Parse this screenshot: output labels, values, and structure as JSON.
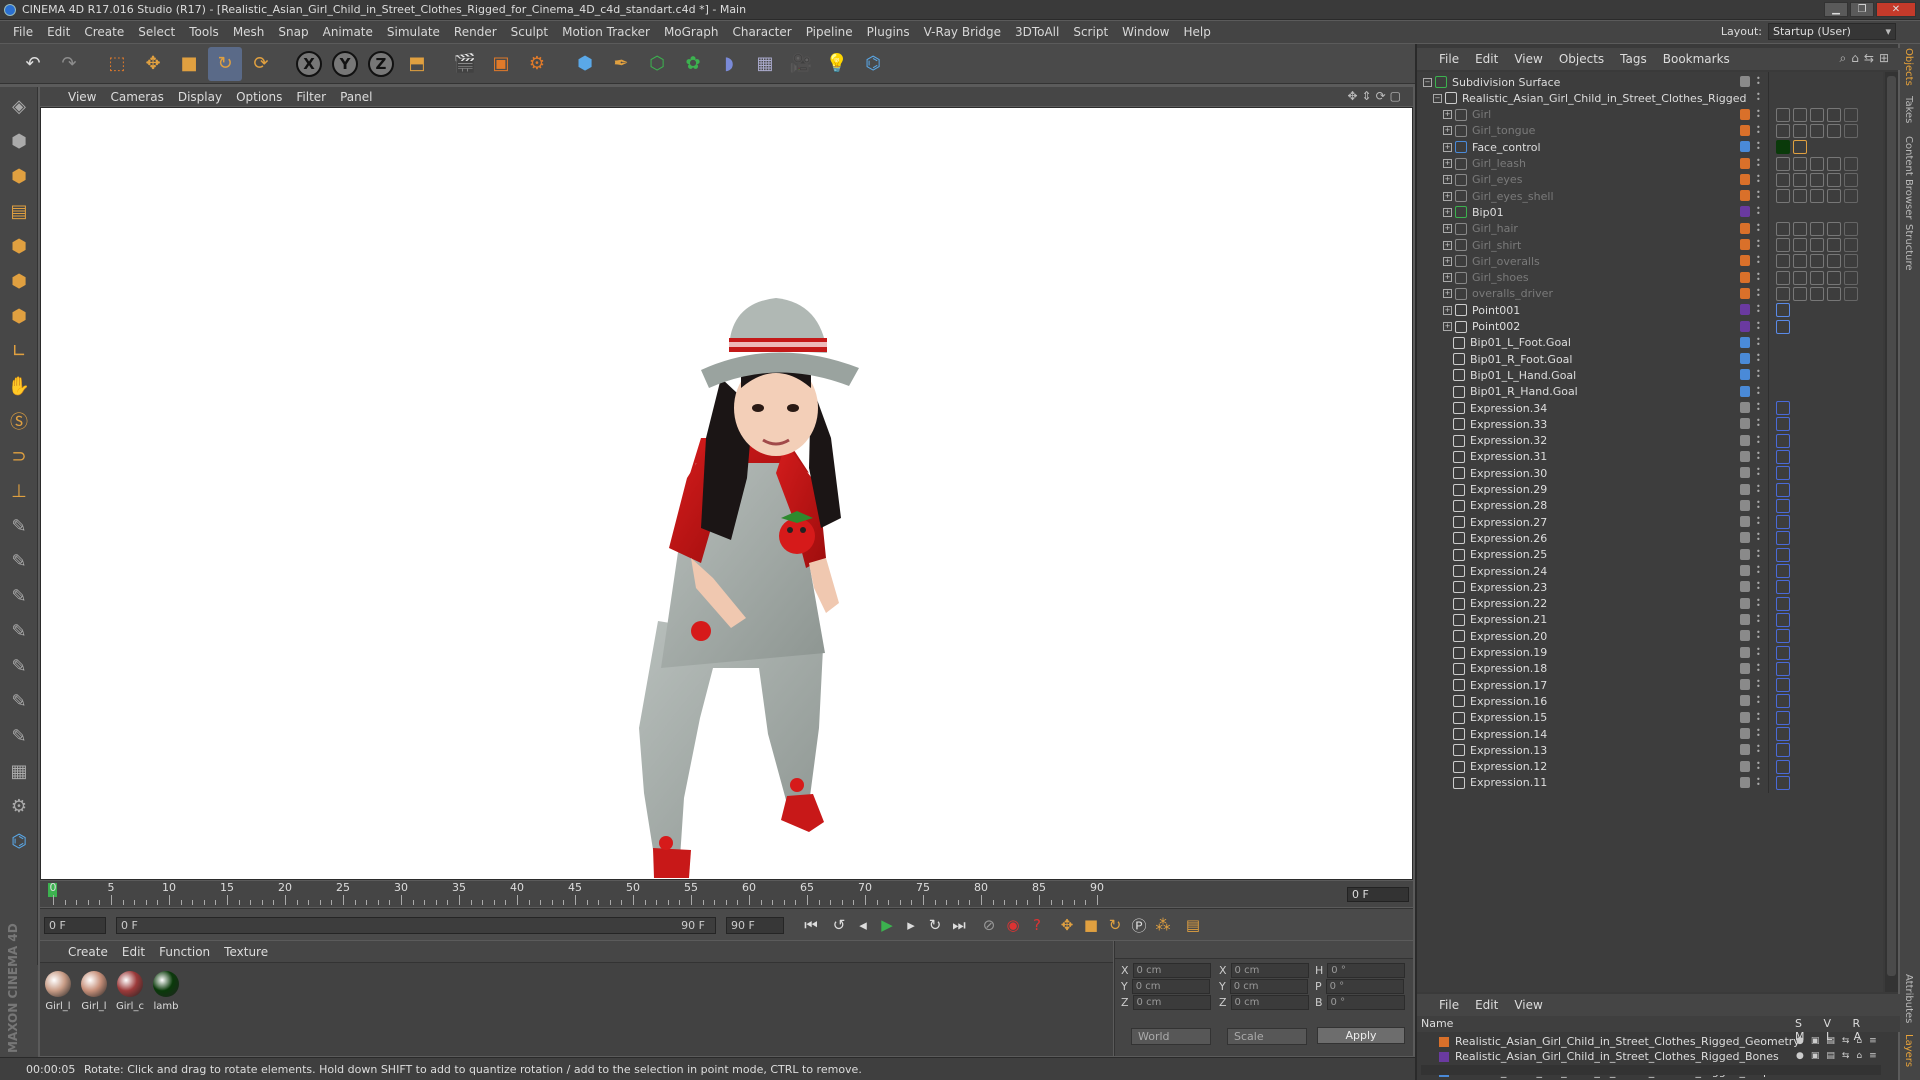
{
  "window": {
    "title": "CINEMA 4D R17.016 Studio (R17) - [Realistic_Asian_Girl_Child_in_Street_Clothes_Rigged_for_Cinema_4D_c4d_standart.c4d *] - Main"
  },
  "menu": [
    "File",
    "Edit",
    "Create",
    "Select",
    "Tools",
    "Mesh",
    "Snap",
    "Animate",
    "Simulate",
    "Render",
    "Sculpt",
    "Motion Tracker",
    "MoGraph",
    "Character",
    "Pipeline",
    "Plugins",
    "V-Ray Bridge",
    "3DToAll",
    "Script",
    "Window",
    "Help"
  ],
  "layout": {
    "label": "Layout:",
    "value": "Startup (User)"
  },
  "toolbar": {
    "x": "X",
    "y": "Y",
    "z": "Z"
  },
  "viewport_menu": [
    "View",
    "Cameras",
    "Display",
    "Options",
    "Filter",
    "Panel"
  ],
  "timeline": {
    "ticks": [
      "0",
      "5",
      "10",
      "15",
      "20",
      "25",
      "30",
      "35",
      "40",
      "45",
      "50",
      "55",
      "60",
      "65",
      "70",
      "75",
      "80",
      "85",
      "90"
    ],
    "current": "0 F"
  },
  "transport": {
    "start": "0 F",
    "range_start": "0 F",
    "range_end": "90 F",
    "end": "90 F"
  },
  "material_menu": [
    "Create",
    "Edit",
    "Function",
    "Texture"
  ],
  "materials": [
    {
      "name": "Girl_l",
      "color": "#c89c86"
    },
    {
      "name": "Girl_l",
      "color": "#c7907a"
    },
    {
      "name": "Girl_c",
      "color": "#9c3a3a"
    },
    {
      "name": "lamb",
      "color": "#0a3a0a"
    }
  ],
  "maxon": "MAXON CINEMA 4D",
  "coords": {
    "x1": "X",
    "y1": "Y",
    "z1": "Z",
    "x2": "X",
    "y2": "Y",
    "z2": "Z",
    "h": "H",
    "p": "P",
    "b": "B",
    "pos": "0 cm",
    "size": "0 cm",
    "rot": "0 °",
    "world": "World",
    "scale": "Scale",
    "apply": "Apply"
  },
  "status": {
    "time": "00:00:05",
    "message": "Rotate: Click and drag to rotate elements. Hold down SHIFT to add to quantize rotation / add to the selection in point mode, CTRL to remove."
  },
  "object_menu": [
    "File",
    "Edit",
    "View",
    "Objects",
    "Tags",
    "Bookmarks"
  ],
  "objects": [
    {
      "name": "Subdivision Surface",
      "depth": 0,
      "dim": false,
      "color": "#8a8a8a",
      "icon": "#3cb24f"
    },
    {
      "name": "Realistic_Asian_Girl_Child_in_Street_Clothes_Rigged",
      "depth": 1,
      "dim": false,
      "color": "",
      "icon": "#cccccc"
    },
    {
      "name": "Girl",
      "depth": 2,
      "dim": true,
      "color": "#d9702a",
      "icon": "#888"
    },
    {
      "name": "Girl_tongue",
      "depth": 2,
      "dim": true,
      "color": "#d9702a",
      "icon": "#888"
    },
    {
      "name": "Face_control",
      "depth": 2,
      "dim": false,
      "color": "#4a8ad8",
      "icon": "#4a8ad8"
    },
    {
      "name": "Girl_leash",
      "depth": 2,
      "dim": true,
      "color": "#d9702a",
      "icon": "#888"
    },
    {
      "name": "Girl_eyes",
      "depth": 2,
      "dim": true,
      "color": "#d9702a",
      "icon": "#888"
    },
    {
      "name": "Girl_eyes_shell",
      "depth": 2,
      "dim": true,
      "color": "#d9702a",
      "icon": "#888"
    },
    {
      "name": "Bip01",
      "depth": 2,
      "dim": false,
      "color": "#6a3aa0",
      "icon": "#3cb24f"
    },
    {
      "name": "Girl_hair",
      "depth": 2,
      "dim": true,
      "color": "#d9702a",
      "icon": "#888"
    },
    {
      "name": "Girl_shirt",
      "depth": 2,
      "dim": true,
      "color": "#d9702a",
      "icon": "#888"
    },
    {
      "name": "Girl_overalls",
      "depth": 2,
      "dim": true,
      "color": "#d9702a",
      "icon": "#888"
    },
    {
      "name": "Girl_shoes",
      "depth": 2,
      "dim": true,
      "color": "#d9702a",
      "icon": "#888"
    },
    {
      "name": "overalls_driver",
      "depth": 2,
      "dim": true,
      "color": "#d9702a",
      "icon": "#888"
    },
    {
      "name": "Point001",
      "depth": 2,
      "dim": false,
      "color": "#6a3aa0",
      "icon": "#ccc"
    },
    {
      "name": "Point002",
      "depth": 2,
      "dim": false,
      "color": "#6a3aa0",
      "icon": "#ccc"
    },
    {
      "name": "Bip01_L_Foot.Goal",
      "depth": 3,
      "dim": false,
      "color": "#4a8ad8",
      "icon": "#ccc"
    },
    {
      "name": "Bip01_R_Foot.Goal",
      "depth": 3,
      "dim": false,
      "color": "#4a8ad8",
      "icon": "#ccc"
    },
    {
      "name": "Bip01_L_Hand.Goal",
      "depth": 3,
      "dim": false,
      "color": "#4a8ad8",
      "icon": "#ccc"
    },
    {
      "name": "Bip01_R_Hand.Goal",
      "depth": 3,
      "dim": false,
      "color": "#4a8ad8",
      "icon": "#ccc"
    },
    {
      "name": "Expression.34",
      "depth": 3,
      "dim": false,
      "color": "#8a8a8a",
      "icon": "#ccc"
    },
    {
      "name": "Expression.33",
      "depth": 3,
      "dim": false,
      "color": "#8a8a8a",
      "icon": "#ccc"
    },
    {
      "name": "Expression.32",
      "depth": 3,
      "dim": false,
      "color": "#8a8a8a",
      "icon": "#ccc"
    },
    {
      "name": "Expression.31",
      "depth": 3,
      "dim": false,
      "color": "#8a8a8a",
      "icon": "#ccc"
    },
    {
      "name": "Expression.30",
      "depth": 3,
      "dim": false,
      "color": "#8a8a8a",
      "icon": "#ccc"
    },
    {
      "name": "Expression.29",
      "depth": 3,
      "dim": false,
      "color": "#8a8a8a",
      "icon": "#ccc"
    },
    {
      "name": "Expression.28",
      "depth": 3,
      "dim": false,
      "color": "#8a8a8a",
      "icon": "#ccc"
    },
    {
      "name": "Expression.27",
      "depth": 3,
      "dim": false,
      "color": "#8a8a8a",
      "icon": "#ccc"
    },
    {
      "name": "Expression.26",
      "depth": 3,
      "dim": false,
      "color": "#8a8a8a",
      "icon": "#ccc"
    },
    {
      "name": "Expression.25",
      "depth": 3,
      "dim": false,
      "color": "#8a8a8a",
      "icon": "#ccc"
    },
    {
      "name": "Expression.24",
      "depth": 3,
      "dim": false,
      "color": "#8a8a8a",
      "icon": "#ccc"
    },
    {
      "name": "Expression.23",
      "depth": 3,
      "dim": false,
      "color": "#8a8a8a",
      "icon": "#ccc"
    },
    {
      "name": "Expression.22",
      "depth": 3,
      "dim": false,
      "color": "#8a8a8a",
      "icon": "#ccc"
    },
    {
      "name": "Expression.21",
      "depth": 3,
      "dim": false,
      "color": "#8a8a8a",
      "icon": "#ccc"
    },
    {
      "name": "Expression.20",
      "depth": 3,
      "dim": false,
      "color": "#8a8a8a",
      "icon": "#ccc"
    },
    {
      "name": "Expression.19",
      "depth": 3,
      "dim": false,
      "color": "#8a8a8a",
      "icon": "#ccc"
    },
    {
      "name": "Expression.18",
      "depth": 3,
      "dim": false,
      "color": "#8a8a8a",
      "icon": "#ccc"
    },
    {
      "name": "Expression.17",
      "depth": 3,
      "dim": false,
      "color": "#8a8a8a",
      "icon": "#ccc"
    },
    {
      "name": "Expression.16",
      "depth": 3,
      "dim": false,
      "color": "#8a8a8a",
      "icon": "#ccc"
    },
    {
      "name": "Expression.15",
      "depth": 3,
      "dim": false,
      "color": "#8a8a8a",
      "icon": "#ccc"
    },
    {
      "name": "Expression.14",
      "depth": 3,
      "dim": false,
      "color": "#8a8a8a",
      "icon": "#ccc"
    },
    {
      "name": "Expression.13",
      "depth": 3,
      "dim": false,
      "color": "#8a8a8a",
      "icon": "#ccc"
    },
    {
      "name": "Expression.12",
      "depth": 3,
      "dim": false,
      "color": "#8a8a8a",
      "icon": "#ccc"
    },
    {
      "name": "Expression.11",
      "depth": 3,
      "dim": false,
      "color": "#8a8a8a",
      "icon": "#ccc"
    }
  ],
  "layers_menu": [
    "File",
    "Edit",
    "View"
  ],
  "layers_cols": {
    "name": "Name",
    "flags": "S V R M L A"
  },
  "layers": [
    {
      "name": "Realistic_Asian_Girl_Child_in_Street_Clothes_Rigged_Geometry",
      "color": "#d9702a"
    },
    {
      "name": "Realistic_Asian_Girl_Child_in_Street_Clothes_Rigged_Bones",
      "color": "#6a3aa0"
    },
    {
      "name": "Realistic_Asian_Girl_Child_in_Street_Clothes_Rigged_Helpers",
      "color": "#4a8ad8"
    }
  ],
  "side_tabs": [
    "Objects",
    "Takes",
    "Content Browser",
    "Structure",
    "Attributes",
    "Layers"
  ]
}
